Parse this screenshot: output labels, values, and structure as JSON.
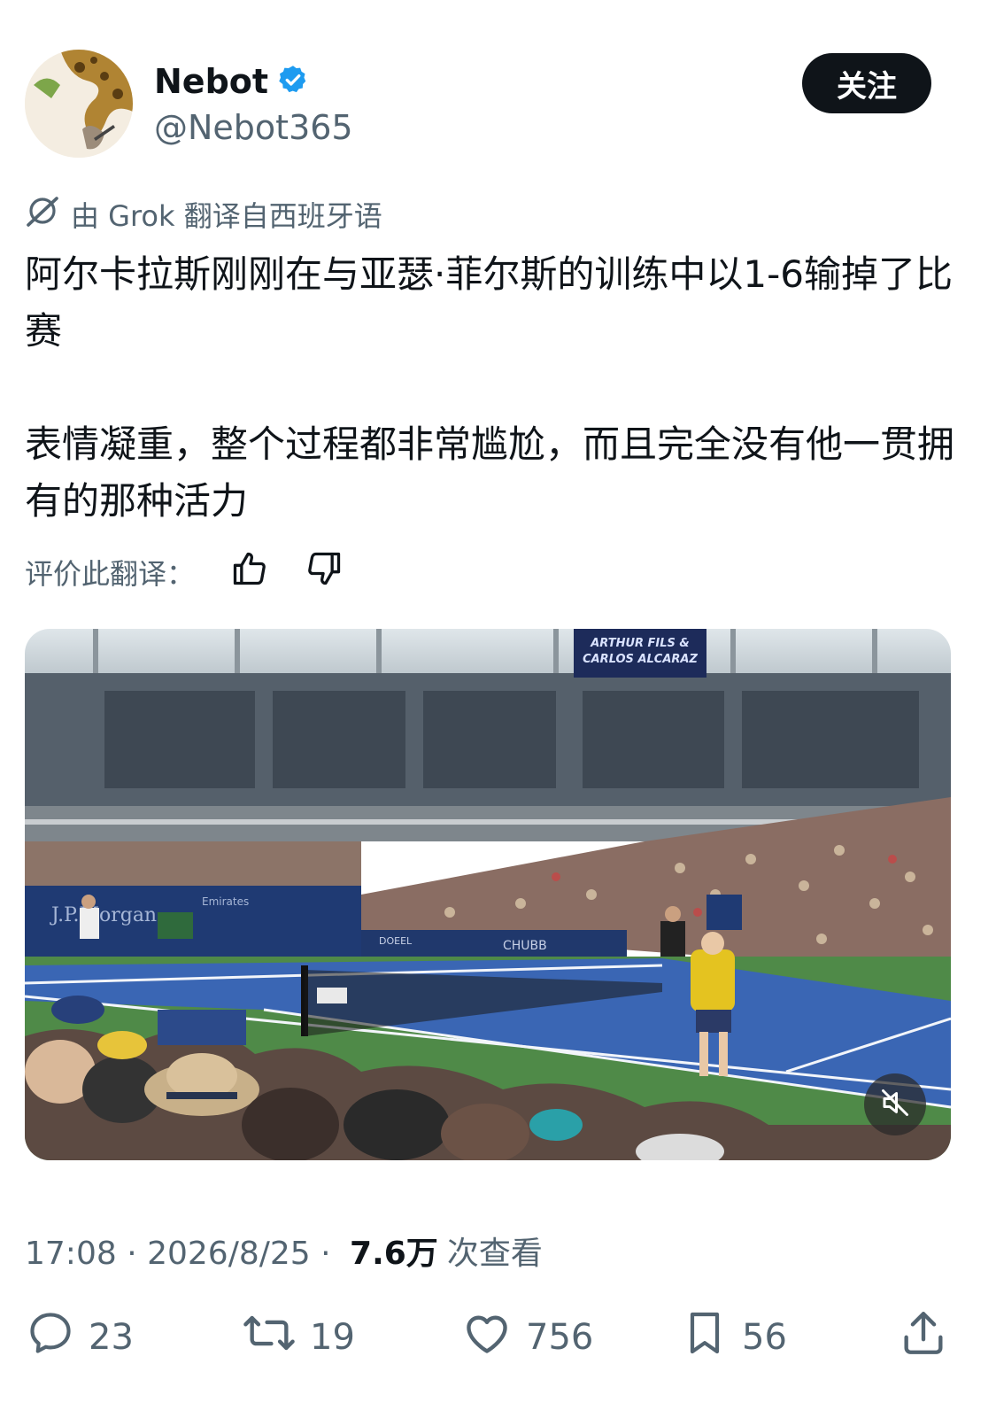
{
  "author": {
    "name": "Nebot",
    "handle": "@Nebot365",
    "verified": true,
    "verified_color": "#1d9bf0"
  },
  "follow_label": "关注",
  "translation": {
    "grok_label": "由 Grok 翻译自西班牙语",
    "rate_label": "评价此翻译："
  },
  "tweet_text": "阿尔卡拉斯刚刚在与亚瑟·菲尔斯的训练中以1-6输掉了比赛\n\n表情凝重，整个过程都非常尴尬，而且完全没有他一贯拥有的那种活力",
  "media": {
    "scoreboard_text_1": "ARTHUR FILS &",
    "scoreboard_text_2": "CARLOS ALCARAZ",
    "banner_jpm": "J.P.Morgan",
    "banner_emirates": "Emirates",
    "banner_chubb": "CHUBB",
    "banner_oppo": "DOEEL",
    "muted": true
  },
  "meta": {
    "time": "17:08",
    "date": "2026/8/25",
    "sep": " · ",
    "views": "7.6万",
    "views_label": "次查看"
  },
  "actions": {
    "replies": "23",
    "retweets": "19",
    "likes": "756",
    "bookmarks": "56"
  },
  "colors": {
    "text": "#0f1419",
    "secondary": "#536471",
    "court_blue": "#3a66b4",
    "court_green": "#4f8a48"
  }
}
